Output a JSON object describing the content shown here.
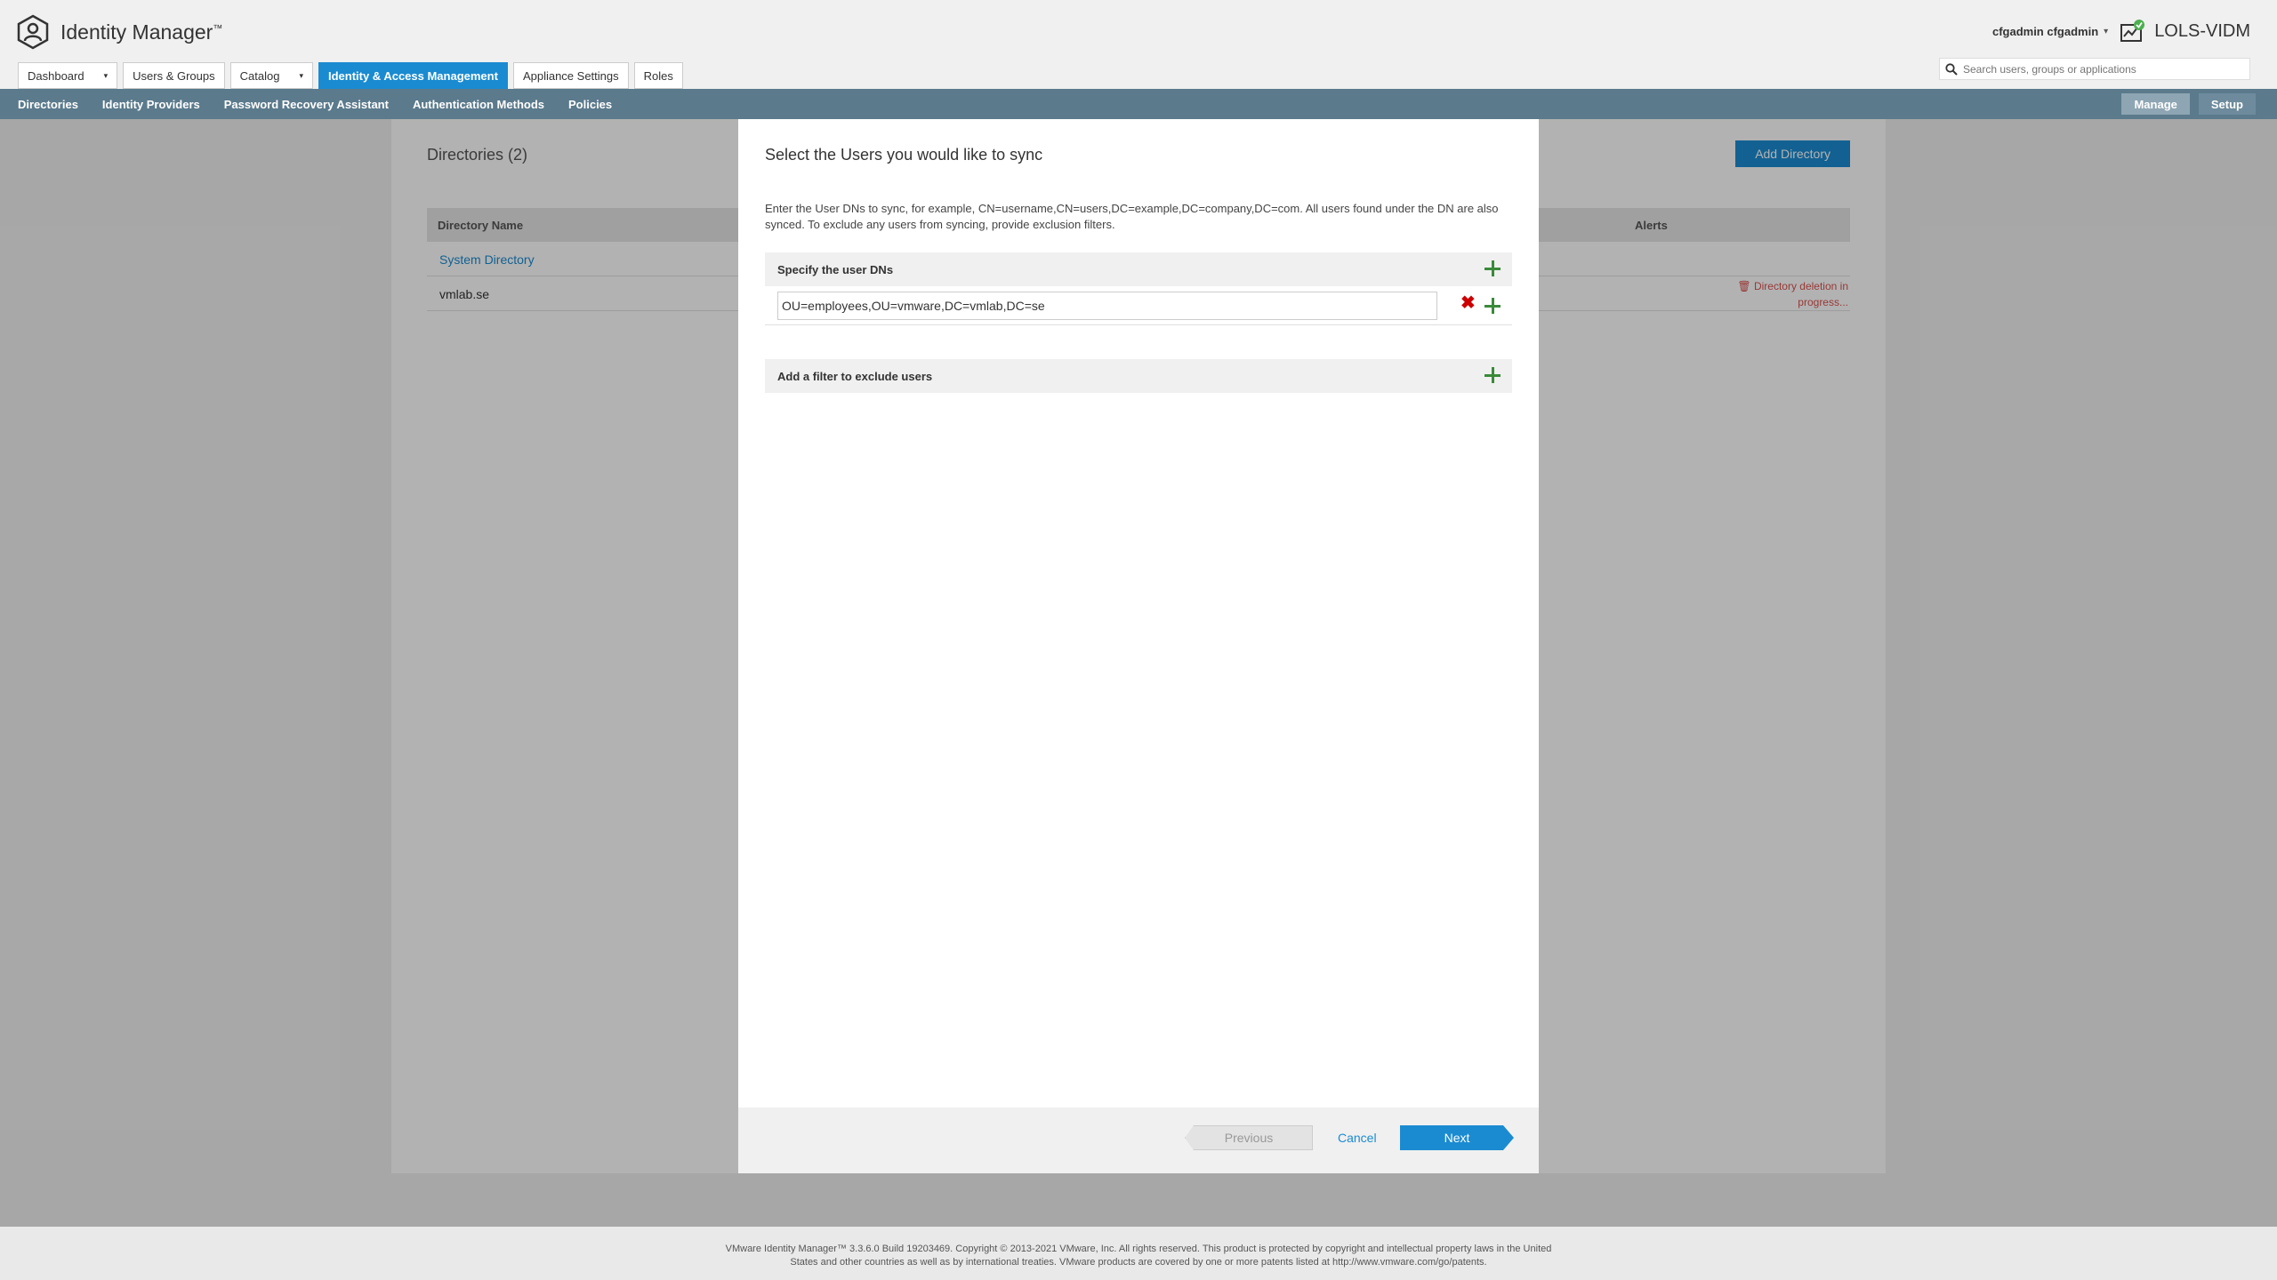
{
  "header": {
    "app_name": "Identity Manager",
    "trademark": "™",
    "user_name": "cfgadmin cfgadmin",
    "user_caret": "▾",
    "tenant_name": "LOLS-VIDM",
    "search_placeholder": "Search users, groups or applications"
  },
  "tabs": [
    {
      "label": "Dashboard",
      "caret": "▾"
    },
    {
      "label": "Users & Groups"
    },
    {
      "label": "Catalog",
      "caret": "▾"
    },
    {
      "label": "Identity & Access Management",
      "active": true
    },
    {
      "label": "Appliance Settings"
    },
    {
      "label": "Roles"
    }
  ],
  "subnav": {
    "items": [
      "Directories",
      "Identity Providers",
      "Password Recovery Assistant",
      "Authentication Methods",
      "Policies"
    ],
    "manage": "Manage",
    "setup": "Setup"
  },
  "page": {
    "title": "Directories (2)",
    "add_button": "Add Directory",
    "columns": {
      "name": "Directory Name",
      "alerts": "Alerts"
    },
    "rows": [
      {
        "name": "System Directory"
      },
      {
        "name": "vmlab.se",
        "alert_line1": "Directory deletion in",
        "alert_line2": "progress..."
      }
    ]
  },
  "modal": {
    "title": "Select the Users you would like to sync",
    "description": "Enter the User DNs to sync, for example, CN=username,CN=users,DC=example,DC=company,DC=com. All users found under the DN are also synced. To exclude any users from syncing, provide exclusion filters.",
    "section_user_dns": "Specify the user DNs",
    "dn_value": "OU=employees,OU=vmware,DC=vmlab,DC=se",
    "remove_glyph": "✖",
    "section_exclude": "Add a filter to exclude users",
    "previous": "Previous",
    "cancel": "Cancel",
    "next": "Next"
  },
  "footer": {
    "line1": "VMware Identity Manager™ 3.3.6.0 Build 19203469. Copyright © 2013-2021 VMware, Inc. All rights reserved. This product is protected by copyright and intellectual property laws in the United",
    "line2": "States and other countries as well as by international treaties. VMware products are covered by one or more patents listed at http://www.vmware.com/go/patents."
  },
  "colors": {
    "accent": "#1a8bd1",
    "subnav": "#5b7a8c",
    "plus_green": "#3a8a3a",
    "remove_red": "#cc0000",
    "alert_red": "#d9534f"
  }
}
